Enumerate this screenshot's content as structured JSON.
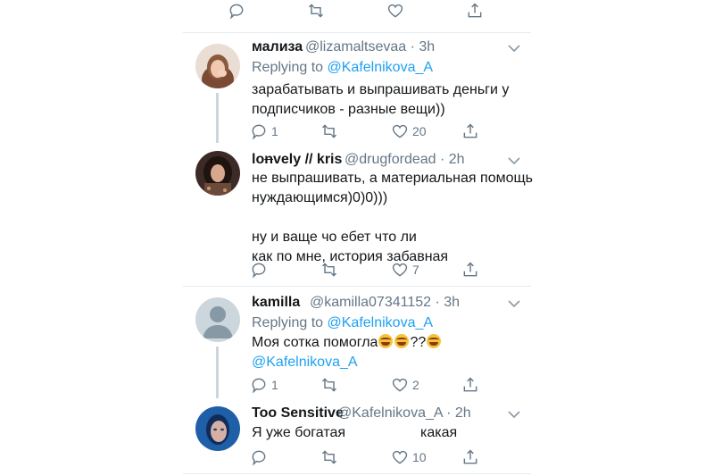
{
  "top_actions": [
    "reply-icon",
    "retweet-icon",
    "like-icon",
    "share-icon"
  ],
  "tweets": [
    {
      "name": "мализа",
      "handle": "@lizamaltsevaa · 3h",
      "reply_prefix": "Replying to",
      "reply_to": "@Kafelnikova_A",
      "text_lines": [
        "зарабатывать и выпрашивать деньги у",
        "подписчиков - разные вещи))"
      ],
      "reply_count": "1",
      "retweet_count": "",
      "like_count": "20"
    },
    {
      "name_part1": "lo",
      "name_strike": "n",
      "name_part2": "vely // kris",
      "handle": "@drugfordead · 2h",
      "text_lines": [
        "не выпрашивать, а материальная помощь",
        "нуждающимся)0)0)))",
        "",
        "ну и ваще чо ебет что ли",
        "как по мне, история забавная"
      ],
      "reply_count": "",
      "retweet_count": "",
      "like_count": "7"
    },
    {
      "name": "kamilla",
      "handle": "@kamilla07341152 · 3h",
      "reply_prefix": "Replying to",
      "reply_to": "@Kafelnikova_A",
      "text_main": "Моя сотка помогла",
      "text_qq": "??",
      "text_mention": "@Kafelnikova_A",
      "reply_count": "1",
      "retweet_count": "",
      "like_count": "2"
    },
    {
      "name": "Too Sensitive",
      "handle": "@Kafelnikova_A · 2h",
      "text_before": "Я уже богатая",
      "text_after": "какая",
      "reply_count": "",
      "retweet_count": "",
      "like_count": "10"
    }
  ],
  "colors": {
    "accent": "#1da1f2",
    "muted": "#657786",
    "text": "#14171a",
    "divider": "#e6ecf0"
  }
}
